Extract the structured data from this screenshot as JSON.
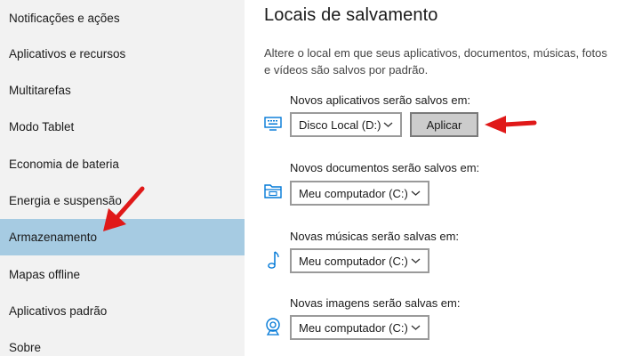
{
  "sidebar": {
    "items": [
      {
        "label": "Notificações e ações"
      },
      {
        "label": "Aplicativos e recursos"
      },
      {
        "label": "Multitarefas"
      },
      {
        "label": "Modo Tablet"
      },
      {
        "label": "Economia de bateria"
      },
      {
        "label": "Energia e suspensão"
      },
      {
        "label": "Armazenamento"
      },
      {
        "label": "Mapas offline"
      },
      {
        "label": "Aplicativos padrão"
      },
      {
        "label": "Sobre"
      }
    ],
    "active_index": 6
  },
  "main": {
    "title": "Locais de salvamento",
    "description": "Altere o local em que seus aplicativos, documentos, músicas, fotos e vídeos são salvos por padrão.",
    "rows": [
      {
        "label": "Novos aplicativos serão salvos em:",
        "value": "Disco Local (D:)",
        "icon": "monitor-keyboard-icon"
      },
      {
        "label": "Novos documentos serão salvos em:",
        "value": "Meu computador (C:)",
        "icon": "folder-icon"
      },
      {
        "label": "Novas músicas serão salvas em:",
        "value": "Meu computador (C:)",
        "icon": "music-note-icon"
      },
      {
        "label": "Novas imagens serão salvas em:",
        "value": "Meu computador (C:)",
        "icon": "webcam-icon"
      }
    ],
    "apply_label": "Aplicar"
  },
  "colors": {
    "active_item": "#a6cbe2",
    "accent": "#0078d7",
    "arrow": "#e01919"
  }
}
